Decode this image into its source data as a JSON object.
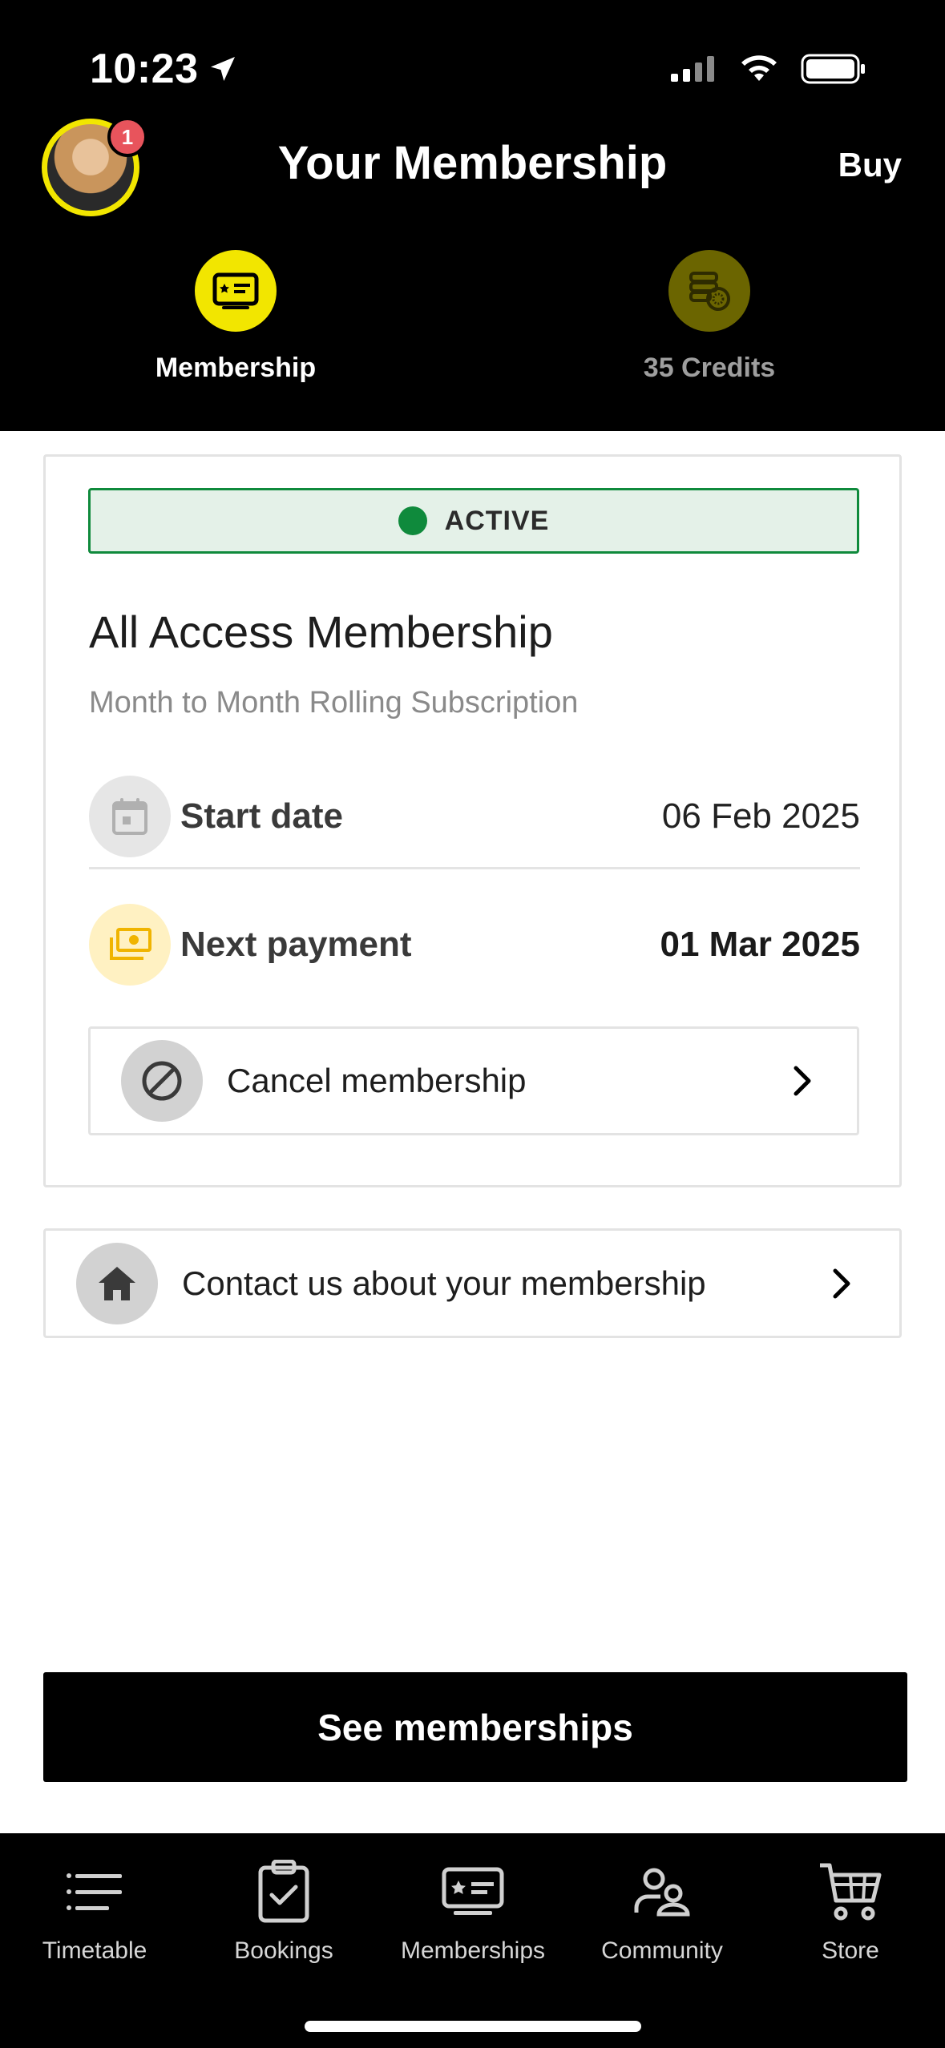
{
  "status_bar": {
    "time": "10:23"
  },
  "header": {
    "title": "Your Membership",
    "buy_label": "Buy",
    "notification_count": "1",
    "segments": [
      {
        "label": "Membership",
        "icon": "membership-card-icon",
        "active": true
      },
      {
        "label": "35 Credits",
        "icon": "credits-coins-icon",
        "active": false
      }
    ]
  },
  "membership": {
    "status": "ACTIVE",
    "status_color": "#0f8a3c",
    "name": "All Access Membership",
    "subtitle": "Month to Month Rolling Subscription",
    "start_label": "Start date",
    "start_value": "06 Feb 2025",
    "next_label": "Next payment",
    "next_value": "01 Mar 2025",
    "cancel_label": "Cancel membership"
  },
  "contact": {
    "label": "Contact us about your membership"
  },
  "primary_button": {
    "label": "See memberships"
  },
  "tabbar": {
    "items": [
      {
        "label": "Timetable",
        "icon": "list-icon"
      },
      {
        "label": "Bookings",
        "icon": "clipboard-check-icon"
      },
      {
        "label": "Memberships",
        "icon": "membership-card-icon"
      },
      {
        "label": "Community",
        "icon": "people-icon"
      },
      {
        "label": "Store",
        "icon": "cart-icon"
      }
    ]
  },
  "colors": {
    "accent": "#f2e600",
    "badge": "#e8545c",
    "active_green": "#0f8a3c"
  }
}
